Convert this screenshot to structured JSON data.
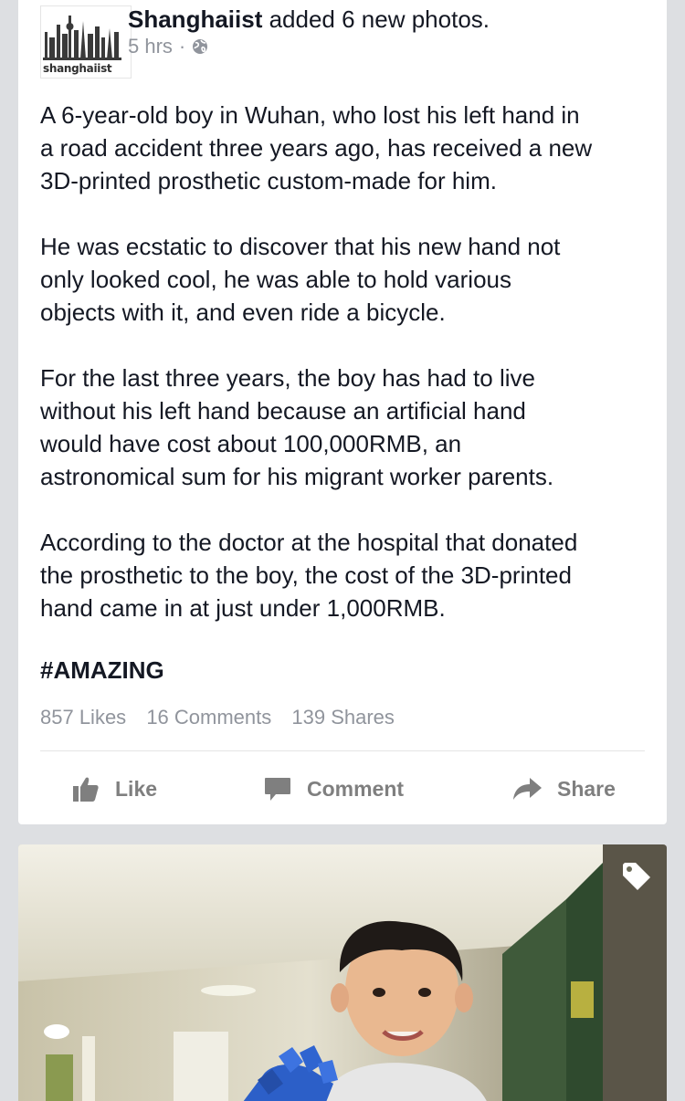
{
  "post": {
    "avatar_label": "shanghaiist",
    "page_name": "Shanghaiist",
    "action_text": "added 6 new photos.",
    "time": "5 hrs",
    "separator": "·",
    "audience_icon": "globe-icon",
    "paragraphs": [
      "A 6-year-old boy in Wuhan, who lost his left hand in\na road accident three years ago, has received a new\n3D-printed prosthetic custom-made for him.",
      "He was ecstatic to discover that his new hand not\nonly looked cool, he was able to hold various\nobjects with it, and even ride a bicycle.",
      "For the last three years, the boy has had to live\nwithout his left hand because an artificial hand\nwould have cost about 100,000RMB, an\nastronomical sum for his migrant worker parents.",
      "According to the doctor at the hospital that donated\nthe prosthetic to the boy, the cost of the 3D-printed\nhand came in at just under 1,000RMB."
    ],
    "hashtag": "#AMAZING",
    "stats": {
      "likes": "857 Likes",
      "comments": "16 Comments",
      "shares": "139 Shares"
    },
    "actions": {
      "like": "Like",
      "comment": "Comment",
      "share": "Share"
    }
  },
  "photo": {
    "tag_icon": "tag-icon"
  },
  "colors": {
    "background": "#dddfe2",
    "card": "#ffffff",
    "text": "#141823",
    "meta": "#90949c",
    "action": "#7f7f7f"
  }
}
